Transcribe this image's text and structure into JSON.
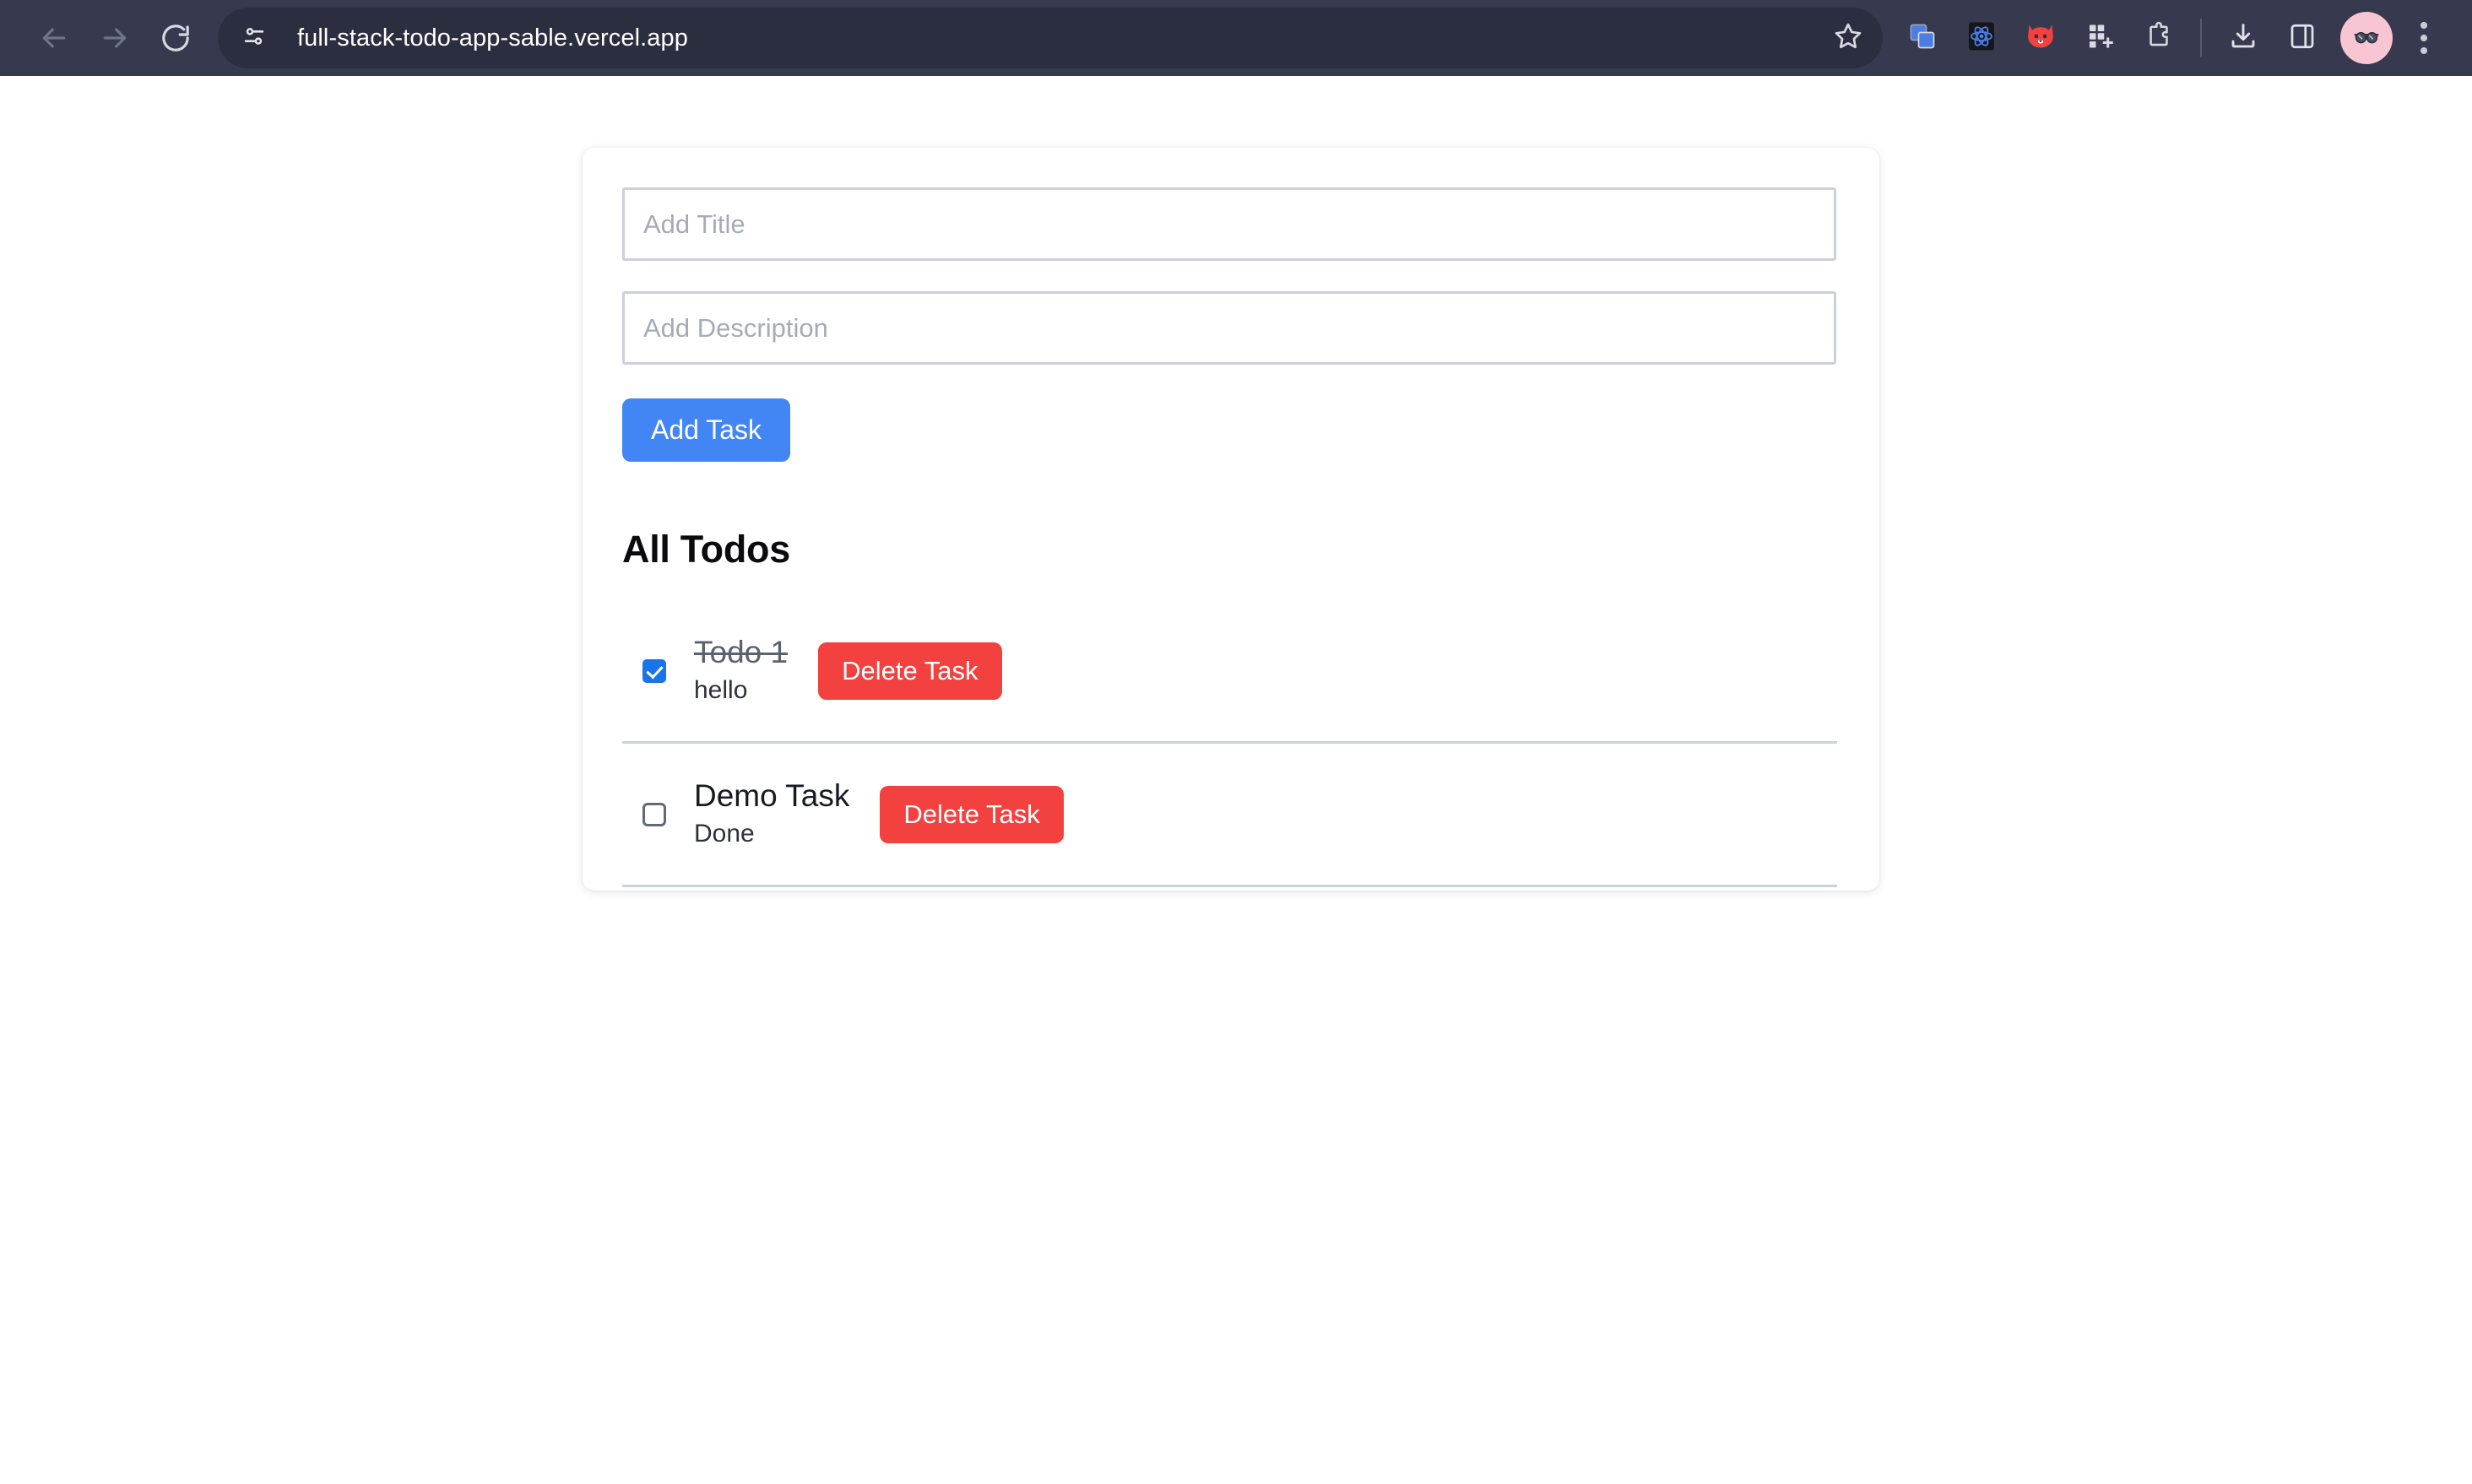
{
  "browser": {
    "back_icon": "arrow-left-icon",
    "forward_icon": "arrow-right-icon",
    "reload_icon": "reload-icon",
    "site_info_icon": "tune-sliders-icon",
    "url": "full-stack-todo-app-sable.vercel.app",
    "bookmark_icon": "star-outline-icon",
    "toolbar_icons": [
      {
        "name": "window-duplicate-icon",
        "label": "Window Manager"
      },
      {
        "name": "react-devtools-icon",
        "label": "React Developer Tools"
      },
      {
        "name": "fox-extension-icon",
        "label": "Fox Extension"
      },
      {
        "name": "grid-plus-icon",
        "label": "Grid Extension"
      },
      {
        "name": "puzzle-piece-icon",
        "label": "Extensions"
      }
    ],
    "download_icon": "download-icon",
    "side_panel_icon": "side-panel-icon",
    "avatar_icon": "avatar-sunglasses-icon",
    "menu_icon": "three-dot-menu-icon",
    "colors": {
      "chrome_bg": "#373a4e",
      "omnibox_bg": "#2b2e3f",
      "avatar_bg": "#f7c6d2"
    }
  },
  "app": {
    "form": {
      "title_input": {
        "value": "",
        "placeholder": "Add Title"
      },
      "description_input": {
        "value": "",
        "placeholder": "Add Description"
      },
      "submit_label": "Add Task"
    },
    "list": {
      "heading": "All Todos",
      "items": [
        {
          "title": "Todo 1",
          "description": "hello",
          "completed": true,
          "delete_label": "Delete Task"
        },
        {
          "title": "Demo Task",
          "description": "Done",
          "completed": false,
          "delete_label": "Delete Task"
        }
      ]
    },
    "colors": {
      "primary": "#4285f4",
      "danger": "#f2413f",
      "checkbox_checked": "#1a73e8",
      "border": "#ccd0da",
      "heading": "#0b0b0d"
    }
  }
}
